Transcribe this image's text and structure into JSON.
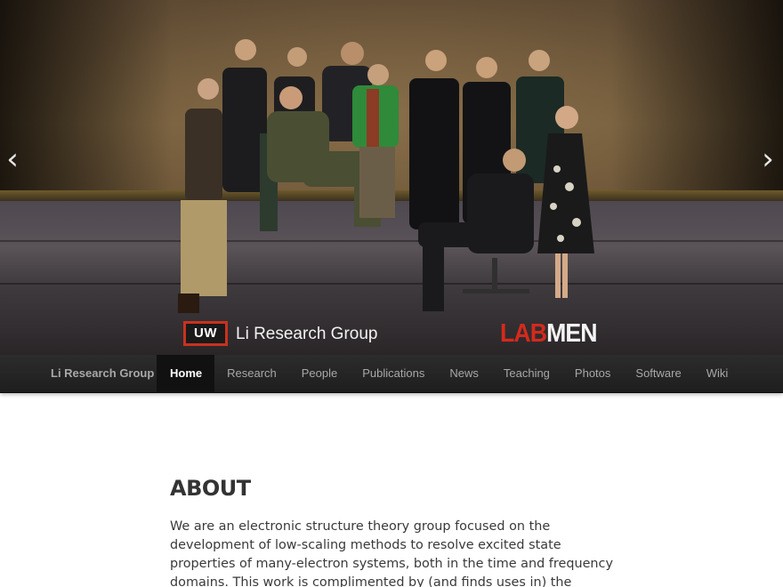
{
  "hero": {
    "logo_badge": "UW",
    "logo_text": "Li Research Group",
    "tagline_part1": "LAB",
    "tagline_part2": "MEN",
    "prev_glyph": "‹",
    "next_glyph": "›",
    "icons": {
      "prev": "chevron-left-icon",
      "next": "chevron-right-icon"
    },
    "colors": {
      "badge_border": "#c8321e",
      "lab": "#d42a1c",
      "men": "#f5f5f5"
    }
  },
  "navbar": {
    "brand": "Li Research Group",
    "items": [
      {
        "label": "Home",
        "active": true
      },
      {
        "label": "Research"
      },
      {
        "label": "People"
      },
      {
        "label": "Publications"
      },
      {
        "label": "News"
      },
      {
        "label": "Teaching"
      },
      {
        "label": "Photos"
      },
      {
        "label": "Software"
      },
      {
        "label": "Wiki"
      }
    ],
    "colors": {
      "background": "#222222",
      "active_background": "#111111",
      "text": "#a8a8a8",
      "active_text": "#ffffff"
    }
  },
  "main": {
    "title": "ABOUT",
    "body": "We are an electronic structure theory group focused on the development of low-scaling methods to resolve excited state properties of many-electron systems, both in the time and frequency domains. This work is complimented by (and finds uses in) the development of efficient methods"
  }
}
